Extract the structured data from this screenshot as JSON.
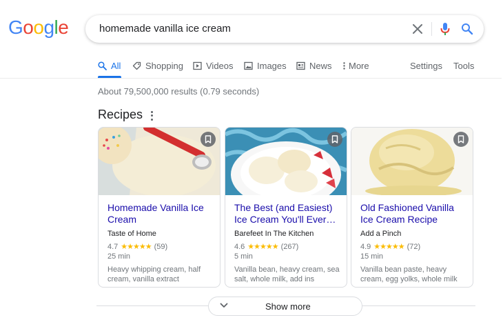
{
  "logo": {
    "g1": "G",
    "o1": "o",
    "o2": "o",
    "g2": "g",
    "l": "l",
    "e": "e"
  },
  "search": {
    "query": "homemade vanilla ice cream"
  },
  "tabs": [
    {
      "label": "All",
      "icon": "search-icon"
    },
    {
      "label": "Shopping",
      "icon": "tag-icon"
    },
    {
      "label": "Videos",
      "icon": "play-icon"
    },
    {
      "label": "Images",
      "icon": "image-icon"
    },
    {
      "label": "News",
      "icon": "news-icon"
    },
    {
      "label": "More",
      "icon": "more-vert-icon"
    },
    {
      "label": "Settings"
    },
    {
      "label": "Tools"
    }
  ],
  "stats": "About 79,500,000 results (0.79 seconds)",
  "recipes": {
    "title": "Recipes",
    "cards": [
      {
        "title": "Homemade Vanilla Ice Cream",
        "source": "Taste of Home",
        "rating": "4.7",
        "stars": "★★★★★",
        "reviews": "(59)",
        "time": "25 min",
        "ingredients": "Heavy whipping cream, half cream, vanilla extract"
      },
      {
        "title": "The Best (and Easiest) Ice Cream You'll Ever…",
        "source": "Barefeet In The Kitchen",
        "rating": "4.6",
        "stars": "★★★★★",
        "reviews": "(267)",
        "time": "5 min",
        "ingredients": "Vanilla bean, heavy cream, sea salt, whole milk, add ins"
      },
      {
        "title": "Old Fashioned Vanilla Ice Cream Recipe",
        "source": "Add a Pinch",
        "rating": "4.9",
        "stars": "★★★★★",
        "reviews": "(72)",
        "time": "15 min",
        "ingredients": "Vanilla bean paste, heavy cream, egg yolks, whole milk"
      }
    ]
  },
  "show_more": "Show more",
  "colors": {
    "accent": "#1a73e8",
    "link": "#1a0dab",
    "star": "#fbbc04"
  }
}
